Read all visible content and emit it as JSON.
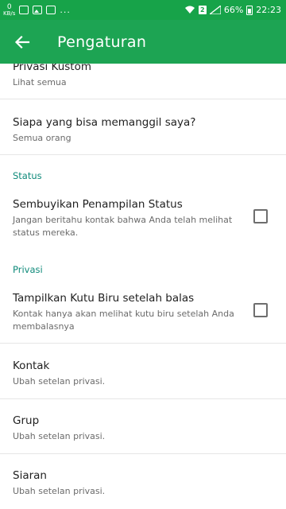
{
  "status_bar": {
    "speed_value": "0",
    "speed_unit": "KB/s",
    "more": "...",
    "sim": "2",
    "battery": "66%",
    "time": "22:23"
  },
  "app_bar": {
    "title": "Pengaturan"
  },
  "items": {
    "custom_privacy": {
      "title": "Privasi Kustom",
      "sub": "Lihat semua"
    },
    "who_can_call": {
      "title": "Siapa yang bisa memanggil saya?",
      "sub": "Semua orang"
    },
    "hide_status_view": {
      "title": "Sembuyikan Penampilan Status",
      "sub": "Jangan beritahu kontak bahwa Anda telah melihat status mereka."
    },
    "blue_ticks": {
      "title": "Tampilkan Kutu Biru setelah balas",
      "sub": "Kontak hanya akan melihat kutu biru setelah Anda membalasnya"
    },
    "contacts": {
      "title": "Kontak",
      "sub": "Ubah setelan privasi."
    },
    "groups": {
      "title": "Grup",
      "sub": "Ubah setelan privasi."
    },
    "broadcasts": {
      "title": "Siaran",
      "sub": "Ubah setelan privasi."
    }
  },
  "sections": {
    "status": "Status",
    "privacy": "Privasi"
  },
  "colors": {
    "status_bar": "#17a349",
    "app_bar": "#1da453",
    "accent": "#0f8a7a"
  }
}
